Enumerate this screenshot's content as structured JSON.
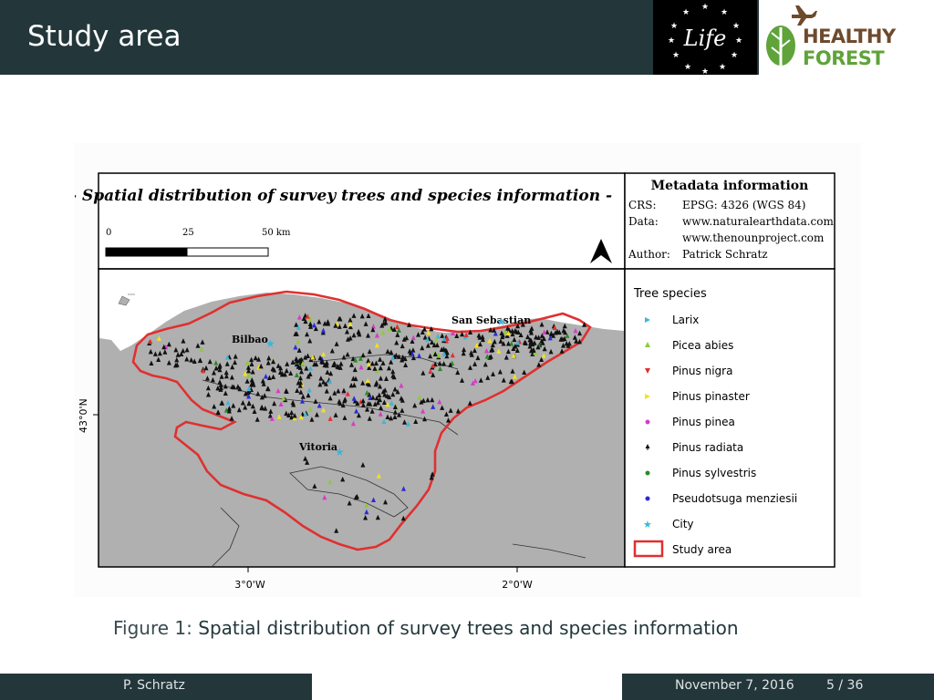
{
  "slide": {
    "title": "Study area",
    "page_current": "5",
    "page_sep": "/",
    "page_total": "36"
  },
  "logos": {
    "life_text": "Life",
    "hf_line1": "HEALTHY",
    "hf_line2": "FOREST"
  },
  "map": {
    "title": "- Spatial distribution of survey trees and species information -",
    "scale_labels": [
      "0",
      "25",
      "50 km"
    ],
    "metadata": {
      "heading": "Metadata information",
      "crs_label": "CRS:",
      "crs_value": "EPSG: 4326 (WGS 84)",
      "data_label": "Data:",
      "data_value1": "www.naturalearthdata.com",
      "data_value2": "www.thenounproject.com",
      "author_label": "Author:",
      "author_value": "Patrick Schratz"
    },
    "cities": [
      "Bilbao",
      "San Sebastian",
      "Vitoria"
    ],
    "axis": {
      "lat_label": "43°0'N",
      "lon_labels": [
        "3°0'W",
        "2°0'W"
      ]
    },
    "legend": {
      "title": "Tree species",
      "items": [
        {
          "label": "Larix",
          "color": "#3bb6d8",
          "symbol": "triangle-right"
        },
        {
          "label": "Picea abies",
          "color": "#8fc93a",
          "symbol": "triangle"
        },
        {
          "label": "Pinus nigra",
          "color": "#e03030",
          "symbol": "triangle-down"
        },
        {
          "label": "Pinus pinaster",
          "color": "#f2e21e",
          "symbol": "triangle-right"
        },
        {
          "label": "Pinus pinea",
          "color": "#d63cc6",
          "symbol": "dot"
        },
        {
          "label": "Pinus radiata",
          "color": "#111111",
          "symbol": "tree"
        },
        {
          "label": "Pinus sylvestris",
          "color": "#2a8a2a",
          "symbol": "dot"
        },
        {
          "label": "Pseudotsuga menziesii",
          "color": "#2a2ad8",
          "symbol": "dot"
        },
        {
          "label": "City",
          "color": "#3bb6d8",
          "symbol": "star"
        },
        {
          "label": "Study area",
          "color": "#e03030",
          "symbol": "rect"
        }
      ]
    }
  },
  "caption": {
    "label": "Figure 1:",
    "text": "Spatial distribution of survey trees and species information"
  },
  "footer": {
    "author": "P. Schratz",
    "date": "November 7, 2016"
  }
}
